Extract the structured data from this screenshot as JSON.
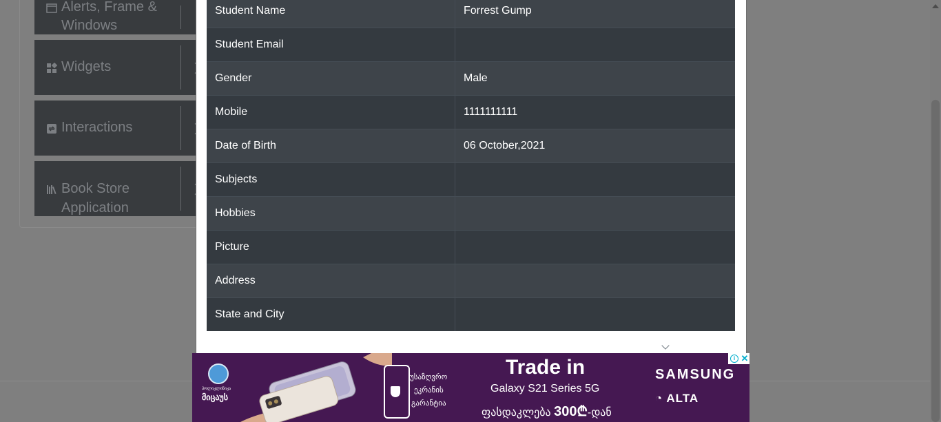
{
  "sidebar": {
    "groups": [
      {
        "label_line1": "Alerts, Frame &",
        "label_line2": "Windows",
        "icon": "window-icon"
      },
      {
        "label": "Widgets",
        "icon": "widgets-icon"
      },
      {
        "label": "Interactions",
        "icon": "interactions-icon"
      },
      {
        "label_line1": "Book Store",
        "label_line2": "Application",
        "icon": "books-icon"
      }
    ]
  },
  "modal": {
    "rows": [
      {
        "label": "Student Name",
        "value": "Forrest Gump"
      },
      {
        "label": "Student Email",
        "value": ""
      },
      {
        "label": "Gender",
        "value": "Male"
      },
      {
        "label": "Mobile",
        "value": "1111111111"
      },
      {
        "label": "Date of Birth",
        "value": "06 October,2021"
      },
      {
        "label": "Subjects",
        "value": ""
      },
      {
        "label": "Hobbies",
        "value": ""
      },
      {
        "label": "Picture",
        "value": ""
      },
      {
        "label": "Address",
        "value": ""
      },
      {
        "label": "State and City",
        "value": ""
      }
    ]
  },
  "ad": {
    "logo_text_small": "პოლიკლინიკა",
    "logo_text": "მიცაუს",
    "badge_line1": "უსაზღვრო",
    "badge_line2": "ეკრანის",
    "badge_line3": "გარანტია",
    "headline": "Trade in",
    "product": "Galaxy S21 Series 5G",
    "price_prefix": "ფასდაკლება",
    "price_amount": "300₾",
    "price_suffix": "-დან",
    "brand1": "SAMSUNG",
    "brand2": "ALTA",
    "background": "#451852"
  },
  "colors": {
    "overlay": "#7f7f7f",
    "table_odd": "#3e444a",
    "table_even": "#343a40",
    "modal_bg": "#ffffff"
  }
}
